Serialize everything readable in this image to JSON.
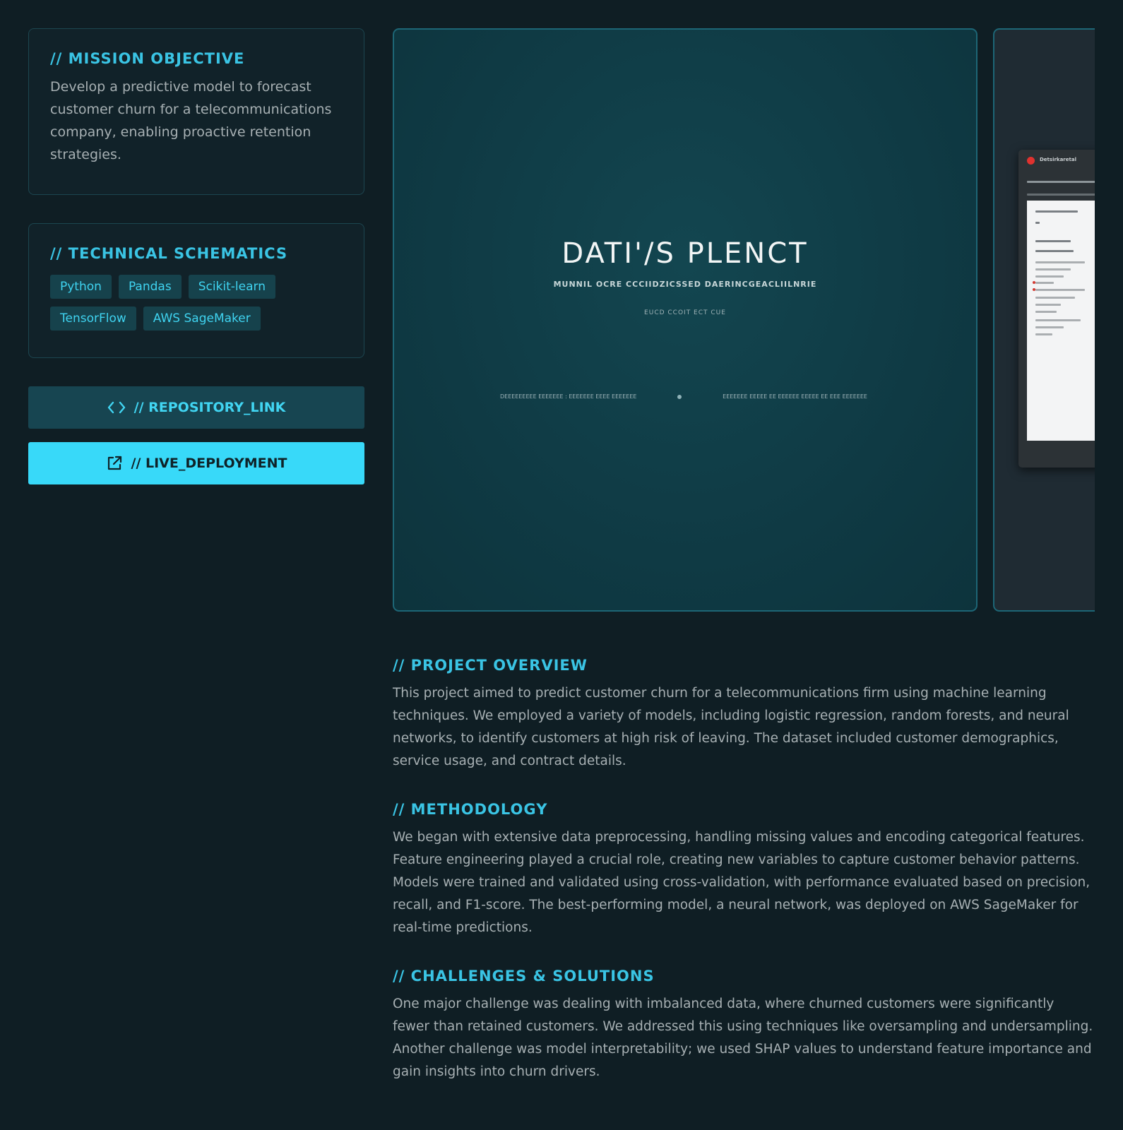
{
  "mission": {
    "title": "// MISSION OBJECTIVE",
    "text": "Develop a predictive model to forecast customer churn for a telecommunications company, enabling proactive retention strategies."
  },
  "schematics": {
    "title": "// TECHNICAL SCHEMATICS",
    "tags": [
      "Python",
      "Pandas",
      "Scikit-learn",
      "TensorFlow",
      "AWS SageMaker"
    ]
  },
  "buttons": {
    "repository": {
      "label": "// REPOSITORY_LINK",
      "icon": "code-icon"
    },
    "live": {
      "label": "// LIVE_DEPLOYMENT",
      "icon": "external-link-icon"
    }
  },
  "gallery": {
    "slide1": {
      "title": "DATI'/S PLENCT",
      "subtitle": "MUNNIL OCRE CCCIIDZICSSED DAERINCGEACLIILNRIE",
      "subtitle2": "EUCD CCOIT ECT CUE",
      "footer_left": "DEEEEEEEEE EEEEEEE : EEEEEEE   EEEE EEEEEEE",
      "footer_right": "EEEEEEE EEEEE EE EEEEEE EEEEE EE EEE EEEEEEE"
    },
    "slide2": {
      "window_title": "Detsirkaretal"
    }
  },
  "overview": {
    "title": "// PROJECT OVERVIEW",
    "text": "This project aimed to predict customer churn for a telecommunications firm using machine learning techniques. We employed a variety of models, including logistic regression, random forests, and neural networks, to identify customers at high risk of leaving. The dataset included customer demographics, service usage, and contract details."
  },
  "methodology": {
    "title": "// METHODOLOGY",
    "text": "We began with extensive data preprocessing, handling missing values and encoding categorical features. Feature engineering played a crucial role, creating new variables to capture customer behavior patterns. Models were trained and validated using cross-validation, with performance evaluated based on precision, recall, and F1-score. The best-performing model, a neural network, was deployed on AWS SageMaker for real-time predictions."
  },
  "challenges": {
    "title": "// CHALLENGES & SOLUTIONS",
    "text": "One major challenge was dealing with imbalanced data, where churned customers were significantly fewer than retained customers. We addressed this using techniques like oversampling and undersampling. Another challenge was model interpretability; we used SHAP values to understand feature importance and gain insights into churn drivers."
  },
  "colors": {
    "background": "#0f1e24",
    "accent": "#38d9f9",
    "heading": "#3ac4e4",
    "body_text": "#a7b0b3"
  }
}
